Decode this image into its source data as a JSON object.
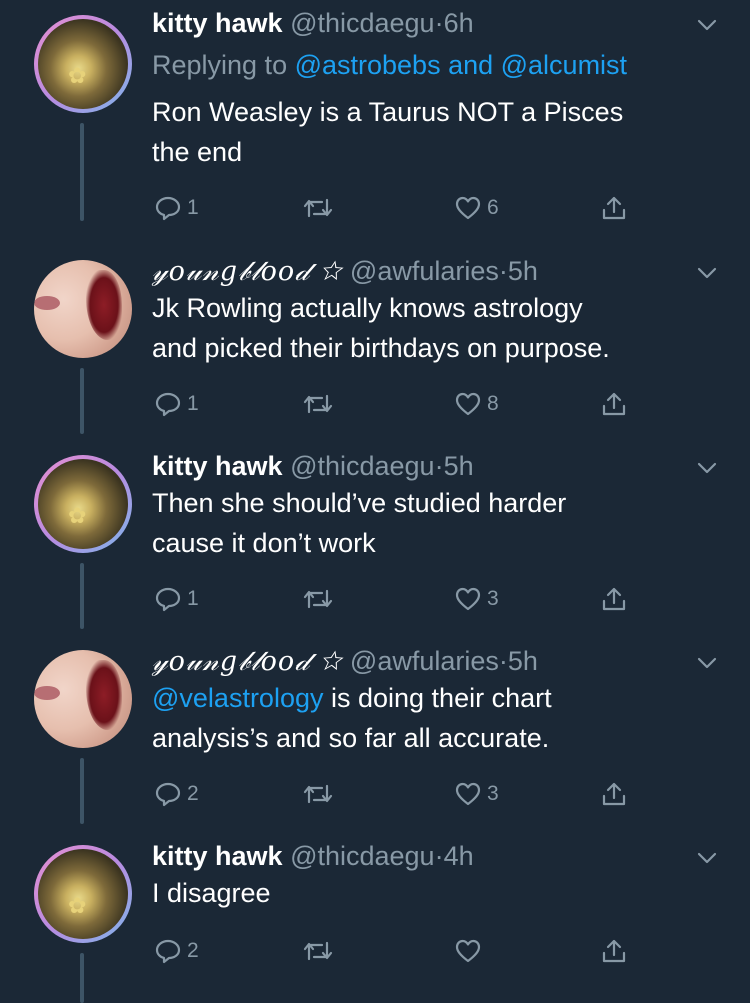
{
  "tweets": [
    {
      "avatar_kind": "kitty",
      "name": "kitty hawk",
      "handle": "@thicdaegu",
      "separator": "·",
      "time": "6h",
      "replying_prefix": "Replying to ",
      "replying_links": "@astrobebs and @alcumist",
      "text_lines": [
        "Ron Weasley is a Taurus NOT a Pisces",
        "the end"
      ],
      "reply_count": "1",
      "retweet_count": "",
      "like_count": "6"
    },
    {
      "avatar_kind": "young",
      "name": "𝓎𝑜𝓊𝓃𝑔𝒷𝓁𝑜𝑜𝒹 ☆",
      "handle": "@awfularies",
      "separator": "·",
      "time": "5h",
      "text_lines": [
        "Jk Rowling actually knows astrology",
        "and picked their birthdays on purpose."
      ],
      "reply_count": "1",
      "retweet_count": "",
      "like_count": "8"
    },
    {
      "avatar_kind": "kitty",
      "name": "kitty hawk",
      "handle": "@thicdaegu",
      "separator": "·",
      "time": "5h",
      "text_lines": [
        "Then she should’ve studied harder",
        "cause it don’t work"
      ],
      "reply_count": "1",
      "retweet_count": "",
      "like_count": "3"
    },
    {
      "avatar_kind": "young",
      "name": "𝓎𝑜𝓊𝓃𝑔𝒷𝓁𝑜𝑜𝒹 ☆",
      "handle": "@awfularies",
      "separator": "·",
      "time": "5h",
      "mention": "@velastrology",
      "text_line1_rest": " is doing their chart",
      "text_lines": [
        "analysis’s and so far all accurate."
      ],
      "reply_count": "2",
      "retweet_count": "",
      "like_count": "3"
    },
    {
      "avatar_kind": "kitty",
      "name": "kitty hawk",
      "handle": "@thicdaegu",
      "separator": "·",
      "time": "4h",
      "text_lines": [
        "I disagree"
      ],
      "reply_count": "2",
      "retweet_count": "",
      "like_count": ""
    }
  ],
  "icons": {
    "reply": "reply-icon",
    "retweet": "retweet-icon",
    "like": "heart-icon",
    "share": "share-icon",
    "menu": "chevron-down-icon"
  },
  "colors": {
    "background": "#1b2836",
    "text": "#ffffff",
    "secondary": "#8899a6",
    "link": "#1da1f2",
    "thread_line": "#3d5466"
  }
}
